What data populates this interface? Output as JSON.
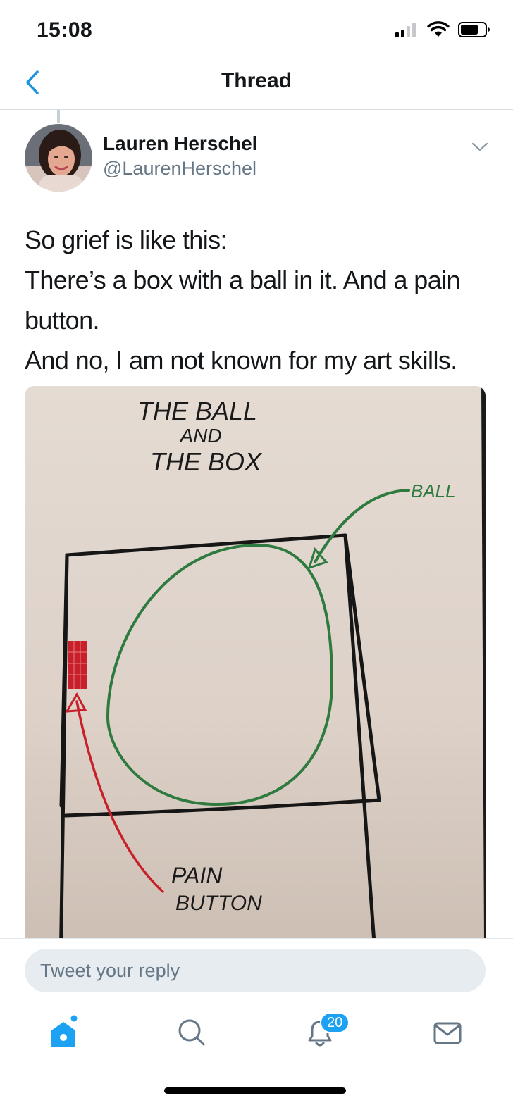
{
  "status_bar": {
    "time": "15:08"
  },
  "nav": {
    "title": "Thread"
  },
  "tweet": {
    "author_name": "Lauren Herschel",
    "author_handle": "@LaurenHerschel",
    "text_lines": [
      "So grief is like this:",
      "There’s a box with a ball in it. And a pain button.",
      "And no, I am not known for my art skills."
    ],
    "image": {
      "title_lines": [
        "THE BALL",
        "AND",
        "THE BOX"
      ],
      "ball_label": "BALL",
      "button_label_lines": [
        "PAIN",
        "BUTTON"
      ]
    }
  },
  "reply": {
    "placeholder": "Tweet your reply"
  },
  "tab_bar": {
    "tabs": [
      {
        "name": "home",
        "icon": "home-icon"
      },
      {
        "name": "search",
        "icon": "search-icon"
      },
      {
        "name": "notifications",
        "icon": "bell-icon"
      },
      {
        "name": "messages",
        "icon": "mail-icon"
      }
    ],
    "notifications_badge": "20"
  },
  "colors": {
    "accent": "#1da1f2",
    "link_blue": "#1b95e0",
    "secondary_text": "#657786",
    "ball_green": "#2f7a3e",
    "button_red": "#c8202a"
  }
}
